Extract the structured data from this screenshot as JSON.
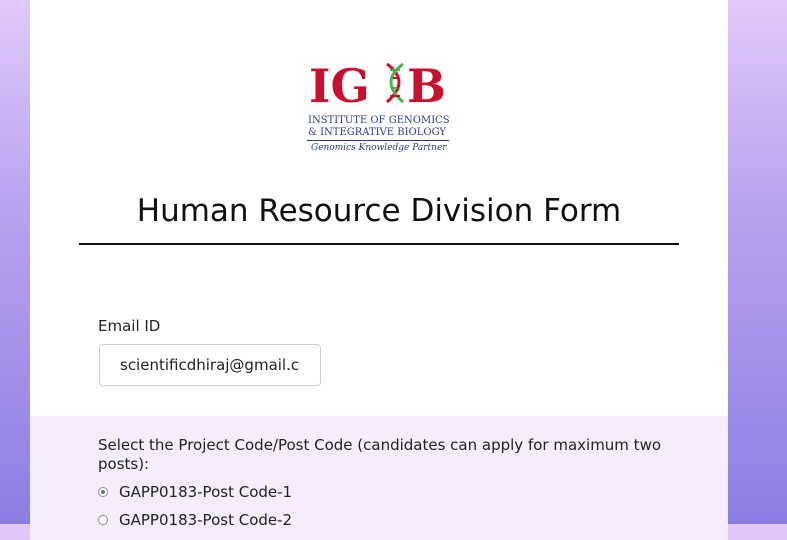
{
  "logo": {
    "mark_left": "IG",
    "mark_right": "B",
    "line1": "INSTITUTE OF GENOMICS",
    "line2": "& INTEGRATIVE BIOLOGY",
    "tagline": "Genomics Knowledge Partner",
    "colors": {
      "mark": "#c8102e",
      "dna_red": "#c8102e",
      "dna_green": "#4caf50",
      "text": "#2d3b8f"
    }
  },
  "form": {
    "title": "Human Resource Division Form",
    "email": {
      "label": "Email ID",
      "value": "scientificdhiraj@gmail.cc"
    },
    "project_question": {
      "label": "Select the Project Code/Post Code (candidates can apply for maximum two posts):",
      "options": [
        {
          "label": "GAPP0183-Post Code-1",
          "selected": true
        },
        {
          "label": "GAPP0183-Post Code-2",
          "selected": false
        }
      ]
    }
  },
  "colors": {
    "background_top": "#e2c9fb",
    "background_bottom": "#8d7ee4",
    "section_bg": "#f6ecfd"
  }
}
